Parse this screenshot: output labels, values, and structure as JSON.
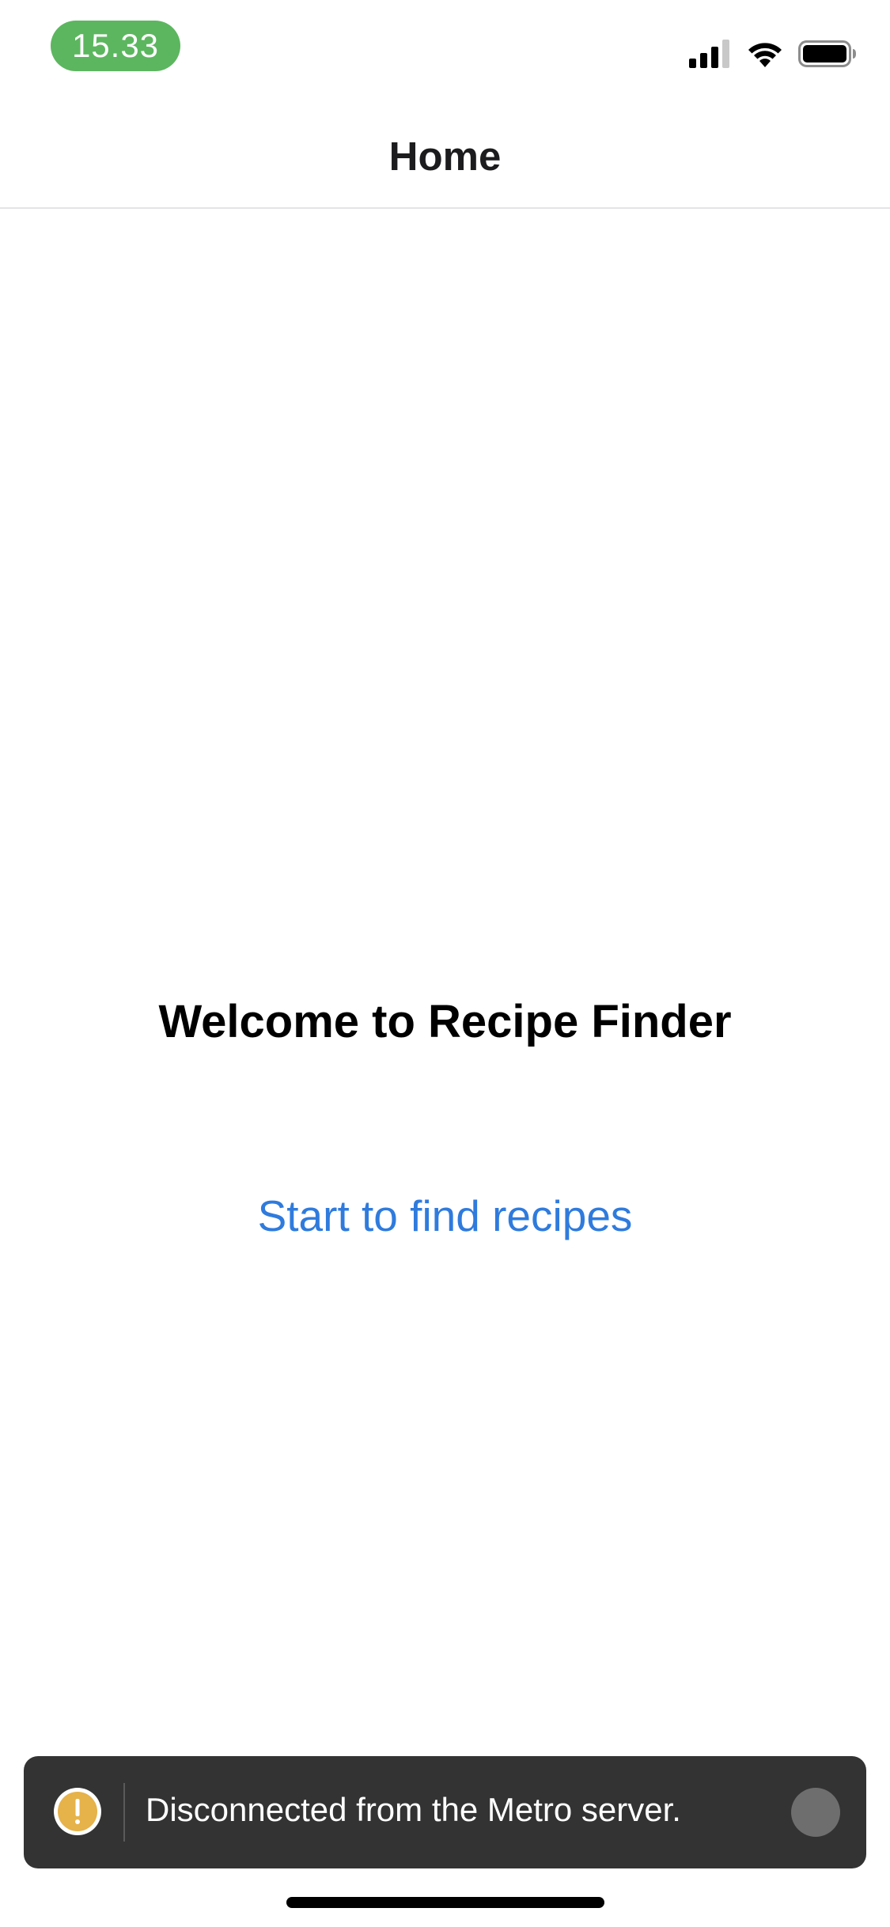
{
  "status_bar": {
    "time": "15.33",
    "signal_icon": "cellular-signal-icon",
    "wifi_icon": "wifi-icon",
    "battery_icon": "battery-icon",
    "time_pill_color": "#5cb65f"
  },
  "header": {
    "title": "Home"
  },
  "main": {
    "welcome_title": "Welcome to Recipe Finder",
    "start_link_label": "Start to find recipes",
    "link_color": "#2f7bdd"
  },
  "toast": {
    "icon": "warning-icon",
    "message": "Disconnected from the Metro server.",
    "dismiss_icon": "dismiss-circle-icon",
    "background_color": "#333333",
    "icon_color": "#e6b24a"
  }
}
